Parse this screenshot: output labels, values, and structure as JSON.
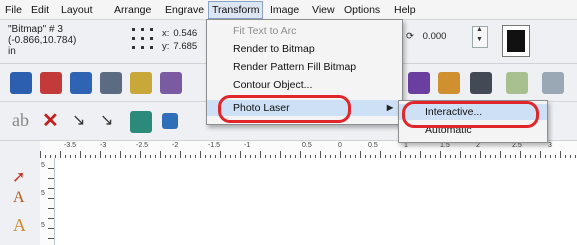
{
  "menubar": {
    "items": [
      "File",
      "Edit",
      "Layout",
      "Arrange",
      "Engrave",
      "Transform",
      "Image",
      "View",
      "Options",
      "Help"
    ],
    "active": "Transform"
  },
  "properties": {
    "object_name": "\"Bitmap\" # 3",
    "coords": "(-0.866,10.784)",
    "units": "in",
    "x_label": "x:",
    "x_value": "0.546",
    "y_label": "y:",
    "y_value": "7.685",
    "rotation_value": "0.000"
  },
  "transform_menu": {
    "items": [
      {
        "label": "Fit Text to Arc",
        "enabled": false
      },
      {
        "label": "Render to Bitmap",
        "enabled": true
      },
      {
        "label": "Render Pattern Fill Bitmap",
        "enabled": true
      },
      {
        "label": "Contour Object...",
        "enabled": true
      },
      {
        "label": "Photo Laser",
        "enabled": true,
        "submenu": true,
        "highlighted": true
      }
    ]
  },
  "photo_laser_submenu": {
    "items": [
      {
        "label": "Interactive...",
        "highlighted": true
      },
      {
        "label": "Automatic",
        "highlighted": false
      }
    ]
  },
  "ruler": {
    "labels": [
      "-3.5",
      "-3",
      "-2.5",
      "-2",
      "-1.5",
      "-1",
      "0.5",
      "0",
      "0.5",
      "1",
      "1.5",
      "2",
      "2.5",
      "3"
    ]
  },
  "vruler": {
    "labels": [
      "5",
      "5",
      "5"
    ]
  },
  "colors": {
    "annotation": "#e0262b",
    "menu_highlight": "#cde0f5",
    "toolbar_bg": "#eef0f3"
  },
  "icons": {
    "toolbar1": [
      "book-icon",
      "picture-icon",
      "save-icon",
      "paste-icon",
      "import-icon",
      "export-icon",
      "layers-icon",
      "palette-icon",
      "print-icon",
      "laser-icon",
      "settings-icon"
    ],
    "toolbar2": [
      "text-icon",
      "cross-icon",
      "node-edit-icon",
      "node-edit-icon",
      "shape-icon",
      "rectangle-icon"
    ],
    "left_tools": [
      "select-arrow-icon",
      "text-tool-icon",
      "text-tool-icon"
    ]
  }
}
